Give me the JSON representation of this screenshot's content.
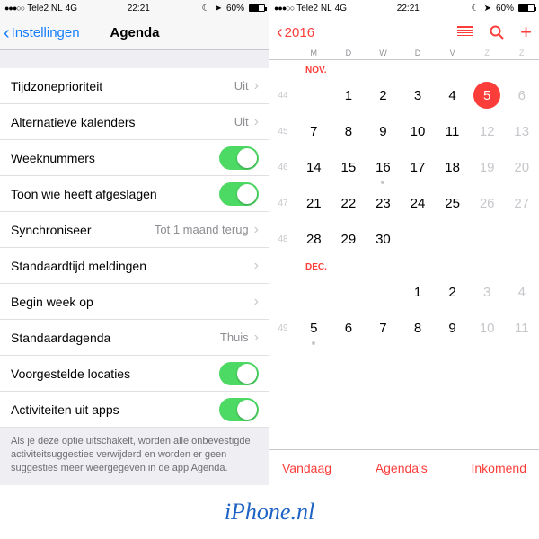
{
  "statusbar": {
    "carrier": "Tele2 NL",
    "network": "4G",
    "time": "22:21",
    "battery_pct": "60%"
  },
  "settings": {
    "back": "Instellingen",
    "title": "Agenda",
    "rows": [
      {
        "label": "Tijdzoneprioriteit",
        "value": "Uit",
        "type": "link"
      },
      {
        "label": "Alternatieve kalenders",
        "value": "Uit",
        "type": "link"
      },
      {
        "label": "Weeknummers",
        "type": "toggle",
        "on": true
      },
      {
        "label": "Toon wie heeft afgeslagen",
        "type": "toggle",
        "on": true
      },
      {
        "label": "Synchroniseer",
        "value": "Tot 1 maand terug",
        "type": "link"
      },
      {
        "label": "Standaardtijd meldingen",
        "type": "link"
      },
      {
        "label": "Begin week op",
        "type": "link"
      },
      {
        "label": "Standaardagenda",
        "value": "Thuis",
        "type": "link"
      },
      {
        "label": "Voorgestelde locaties",
        "type": "toggle",
        "on": true
      },
      {
        "label": "Activiteiten uit apps",
        "type": "toggle",
        "on": true
      }
    ],
    "note": "Als je deze optie uitschakelt, worden alle onbevestigde activiteitsuggesties verwijderd en worden er geen suggesties meer weergegeven in de app Agenda."
  },
  "calendar": {
    "back": "2016",
    "day_initials": [
      "M",
      "D",
      "W",
      "D",
      "V",
      "Z",
      "Z"
    ],
    "months": [
      {
        "label": "NOV.",
        "weeks": [
          {
            "wk": "44",
            "days": [
              null,
              {
                "n": "1"
              },
              {
                "n": "2"
              },
              {
                "n": "3"
              },
              {
                "n": "4"
              },
              {
                "n": "5",
                "today": true,
                "dim": false
              },
              {
                "n": "6",
                "dim": true
              }
            ]
          },
          {
            "wk": "45",
            "days": [
              {
                "n": "7"
              },
              {
                "n": "8"
              },
              {
                "n": "9"
              },
              {
                "n": "10"
              },
              {
                "n": "11"
              },
              {
                "n": "12",
                "dim": true
              },
              {
                "n": "13",
                "dim": true
              }
            ]
          },
          {
            "wk": "46",
            "days": [
              {
                "n": "14"
              },
              {
                "n": "15"
              },
              {
                "n": "16",
                "dot": true
              },
              {
                "n": "17"
              },
              {
                "n": "18"
              },
              {
                "n": "19",
                "dim": true
              },
              {
                "n": "20",
                "dim": true
              }
            ]
          },
          {
            "wk": "47",
            "days": [
              {
                "n": "21"
              },
              {
                "n": "22"
              },
              {
                "n": "23"
              },
              {
                "n": "24"
              },
              {
                "n": "25"
              },
              {
                "n": "26",
                "dim": true
              },
              {
                "n": "27",
                "dim": true
              }
            ]
          },
          {
            "wk": "48",
            "days": [
              {
                "n": "28"
              },
              {
                "n": "29"
              },
              {
                "n": "30"
              },
              null,
              null,
              null,
              null
            ]
          }
        ]
      },
      {
        "label": "DEC.",
        "weeks": [
          {
            "wk": "",
            "days": [
              null,
              null,
              null,
              {
                "n": "1"
              },
              {
                "n": "2"
              },
              {
                "n": "3",
                "dim": true
              },
              {
                "n": "4",
                "dim": true
              }
            ]
          },
          {
            "wk": "49",
            "days": [
              {
                "n": "5",
                "dot": true
              },
              {
                "n": "6"
              },
              {
                "n": "7"
              },
              {
                "n": "8"
              },
              {
                "n": "9"
              },
              {
                "n": "10",
                "dim": true
              },
              {
                "n": "11",
                "dim": true
              }
            ]
          }
        ]
      }
    ],
    "toolbar": {
      "today": "Vandaag",
      "calendars": "Agenda's",
      "inbox": "Inkomend"
    }
  },
  "footer": "iPhone.nl"
}
